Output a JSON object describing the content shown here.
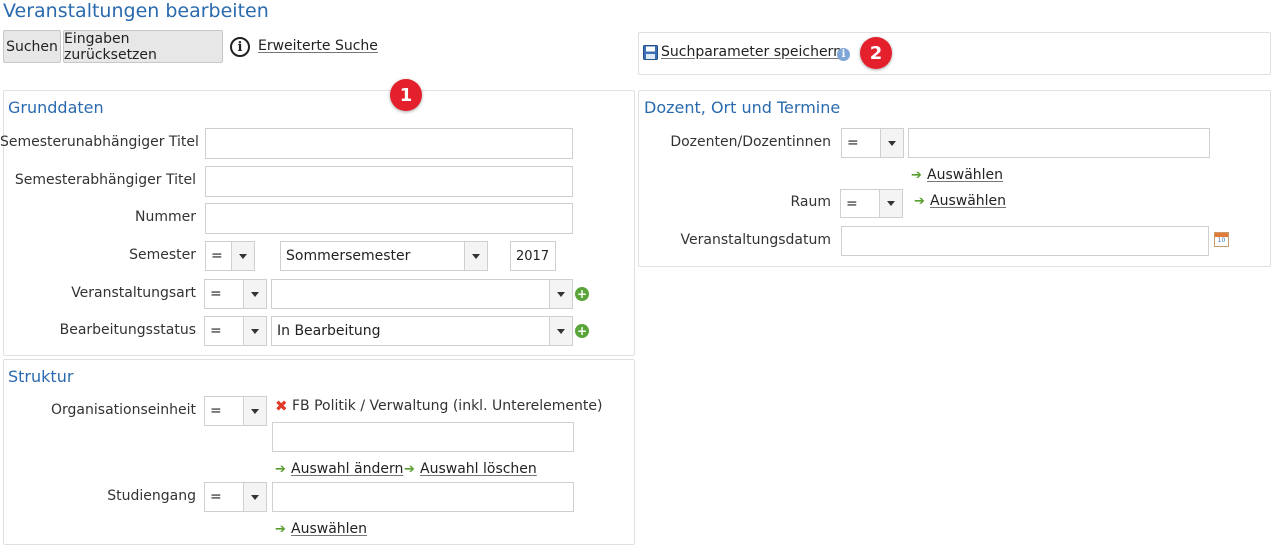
{
  "page": {
    "title": "Veranstaltungen bearbeiten"
  },
  "toolbar": {
    "search_label": "Suchen",
    "reset_label": "Eingaben zurücksetzen",
    "info_symbol": "i",
    "advanced_search_label": "Erweiterte Suche",
    "save_params_label": "Suchparameter speichern",
    "small_info_symbol": "i"
  },
  "badges": {
    "one": "1",
    "two": "2"
  },
  "grunddaten": {
    "title": "Grunddaten",
    "semester_independent_title_label": "Semesterunabhängiger Titel",
    "semester_independent_title_value": "",
    "semester_dependent_title_label": "Semesterabhängiger Titel",
    "semester_dependent_title_value": "",
    "number_label": "Nummer",
    "number_value": "",
    "semester_label": "Semester",
    "semester_operator": "=",
    "semester_term": "Sommersemester",
    "semester_year": "2017",
    "event_type_label": "Veranstaltungsart",
    "event_type_operator": "=",
    "event_type_value": "",
    "status_label": "Bearbeitungsstatus",
    "status_operator": "=",
    "status_value": "In Bearbeitung",
    "plus_symbol": "+"
  },
  "struktur": {
    "title": "Struktur",
    "org_unit_label": "Organisationseinheit",
    "org_unit_operator": "=",
    "org_unit_selected": "FB Politik / Verwaltung (inkl. Unterelemente)",
    "org_unit_input_value": "",
    "change_selection_label": "Auswahl ändern",
    "delete_selection_label": "Auswahl löschen",
    "study_program_label": "Studiengang",
    "study_program_operator": "=",
    "study_program_value": "",
    "select_label": "Auswählen",
    "remove_symbol": "✖",
    "arrow_symbol": "➔"
  },
  "dozent": {
    "title": "Dozent, Ort und Termine",
    "lecturers_label": "Dozenten/Dozentinnen",
    "lecturers_operator": "=",
    "lecturers_value": "",
    "lecturers_select_label": "Auswählen",
    "room_label": "Raum",
    "room_operator": "=",
    "room_select_label": "Auswählen",
    "date_label": "Veranstaltungsdatum",
    "date_value": "",
    "calendar_day": "10",
    "arrow_symbol": "➔"
  },
  "colors": {
    "accent": "#2a6aae",
    "badge": "#e3202c",
    "add": "#5aa53a",
    "remove": "#e03a2a"
  }
}
